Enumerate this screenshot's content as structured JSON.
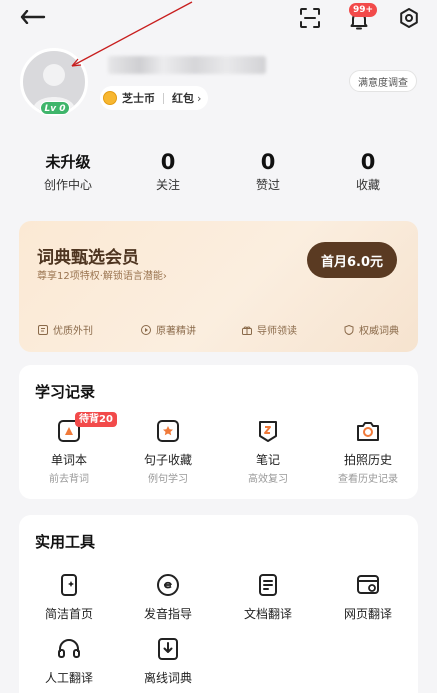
{
  "header": {
    "notification_badge": "99+"
  },
  "profile": {
    "level_badge": "Lv 0",
    "coin_label": "芝士币",
    "redpacket_label": "红包",
    "survey_label": "满意度调查"
  },
  "stats": [
    {
      "value": "未升级",
      "label": "创作中心"
    },
    {
      "value": "0",
      "label": "关注"
    },
    {
      "value": "0",
      "label": "赞过"
    },
    {
      "value": "0",
      "label": "收藏"
    }
  ],
  "vip": {
    "title": "词典甄选会员",
    "subtitle": "尊享12项特权·解锁语言潜能",
    "button_label": "首月6.0元",
    "perks": [
      "优质外刊",
      "原著精讲",
      "导师领读",
      "权威词典"
    ]
  },
  "study": {
    "title": "学习记录",
    "pending_badge": "待背20",
    "items": [
      {
        "label": "单词本",
        "sub": "前去背词"
      },
      {
        "label": "句子收藏",
        "sub": "例句学习"
      },
      {
        "label": "笔记",
        "sub": "高效复习"
      },
      {
        "label": "拍照历史",
        "sub": "查看历史记录"
      }
    ]
  },
  "tools": {
    "title": "实用工具",
    "items": [
      {
        "label": "简洁首页"
      },
      {
        "label": "发音指导"
      },
      {
        "label": "文档翻译"
      },
      {
        "label": "网页翻译"
      },
      {
        "label": "人工翻译"
      },
      {
        "label": "离线词典"
      }
    ]
  },
  "colors": {
    "accent_red": "#f24a4a",
    "vip_button": "#5a3a22",
    "level_green": "#3fb56b"
  }
}
